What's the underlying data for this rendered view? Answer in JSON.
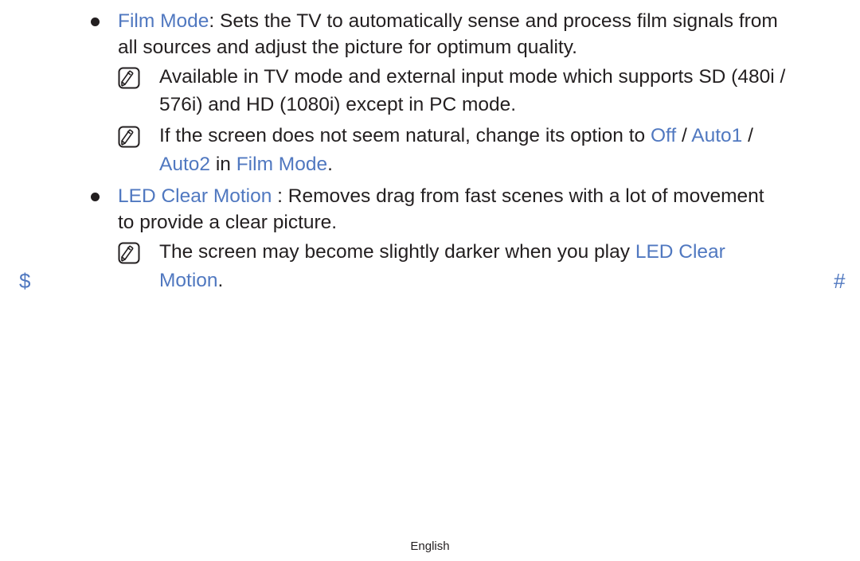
{
  "accent_color": "#5078c0",
  "items": [
    {
      "term": "Film Mode",
      "sep": ": ",
      "desc_line1": "Sets the TV to automatically sense and process film signals from",
      "desc_line2": "all sources and adjust the picture for optimum quality.",
      "notes": [
        {
          "icon": "note-icon",
          "line1": "Available in TV mode and external input mode which supports SD (480i /",
          "line2": "576i) and HD (1080i) except in PC mode."
        },
        {
          "icon": "note-icon",
          "line1_pre": "If the screen does not seem natural, change its option to ",
          "opt_off": "Off",
          "slash1": " / ",
          "opt_auto1": "Auto1",
          "slash2": " /",
          "opt_auto2": "Auto2",
          "in_text": " in ",
          "film_mode": "Film Mode",
          "period": "."
        }
      ]
    },
    {
      "term": "LED Clear Motion",
      "sep": " : ",
      "desc_line1": "Removes drag from fast scenes with a lot of movement",
      "desc_line2": "to provide a clear picture.",
      "notes": [
        {
          "icon": "note-icon",
          "line1_pre": "The screen may become slightly darker when you play ",
          "hl1": "LED Clear",
          "hl2": "Motion",
          "period": "."
        }
      ]
    }
  ],
  "nav": {
    "prev": "$",
    "next": "#"
  },
  "footer": {
    "language": "English"
  }
}
